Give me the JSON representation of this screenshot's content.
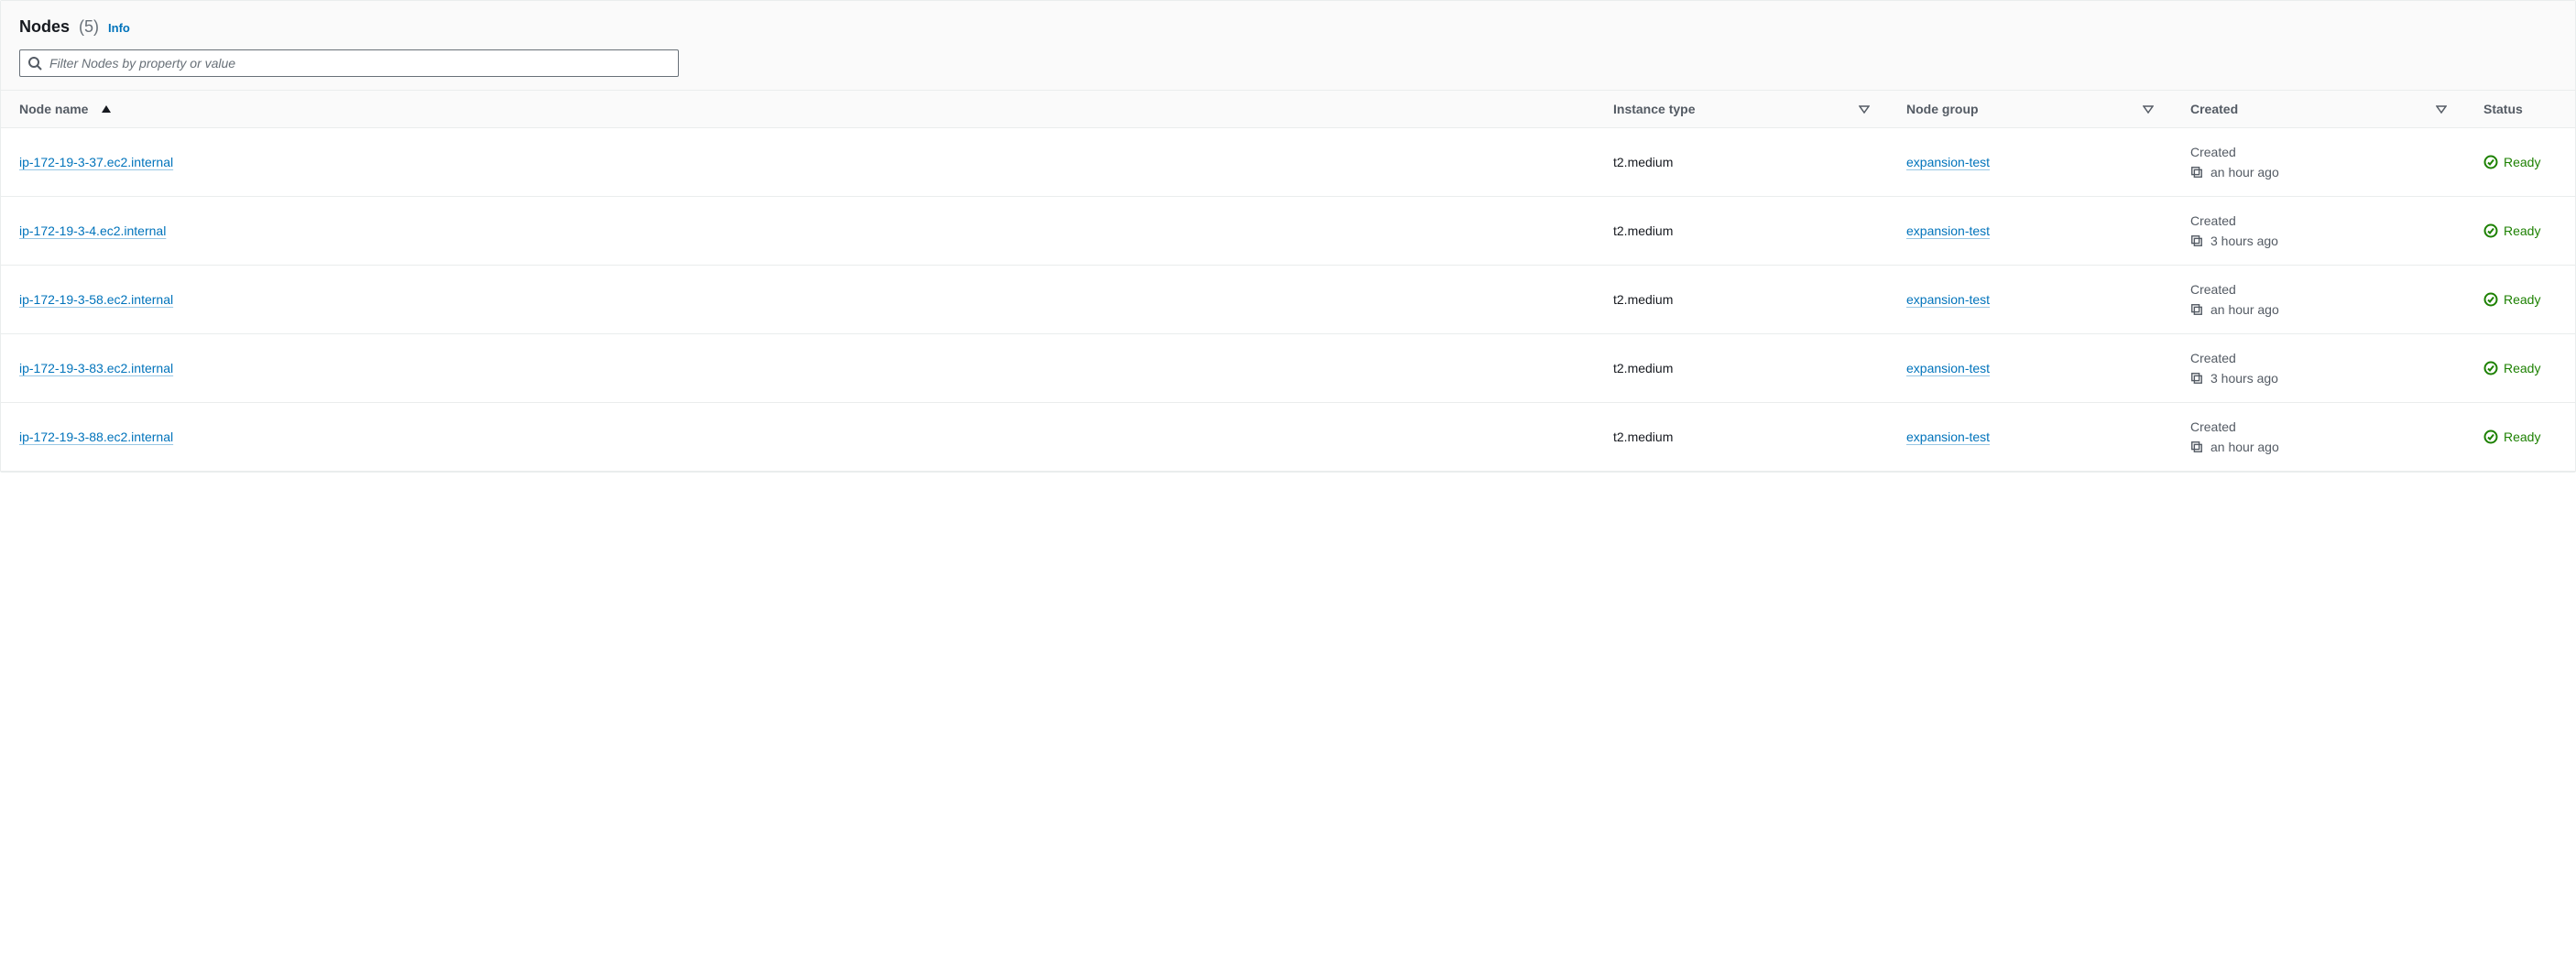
{
  "header": {
    "title": "Nodes",
    "count": "(5)",
    "info": "Info"
  },
  "filter": {
    "placeholder": "Filter Nodes by property or value"
  },
  "columns": {
    "node_name": "Node name",
    "instance_type": "Instance type",
    "node_group": "Node group",
    "created": "Created",
    "status": "Status"
  },
  "created_label": "Created",
  "rows": [
    {
      "node_name": "ip-172-19-3-37.ec2.internal",
      "instance_type": "t2.medium",
      "node_group": "expansion-test",
      "created": "an hour ago",
      "status": "Ready"
    },
    {
      "node_name": "ip-172-19-3-4.ec2.internal",
      "instance_type": "t2.medium",
      "node_group": "expansion-test",
      "created": "3 hours ago",
      "status": "Ready"
    },
    {
      "node_name": "ip-172-19-3-58.ec2.internal",
      "instance_type": "t2.medium",
      "node_group": "expansion-test",
      "created": "an hour ago",
      "status": "Ready"
    },
    {
      "node_name": "ip-172-19-3-83.ec2.internal",
      "instance_type": "t2.medium",
      "node_group": "expansion-test",
      "created": "3 hours ago",
      "status": "Ready"
    },
    {
      "node_name": "ip-172-19-3-88.ec2.internal",
      "instance_type": "t2.medium",
      "node_group": "expansion-test",
      "created": "an hour ago",
      "status": "Ready"
    }
  ]
}
